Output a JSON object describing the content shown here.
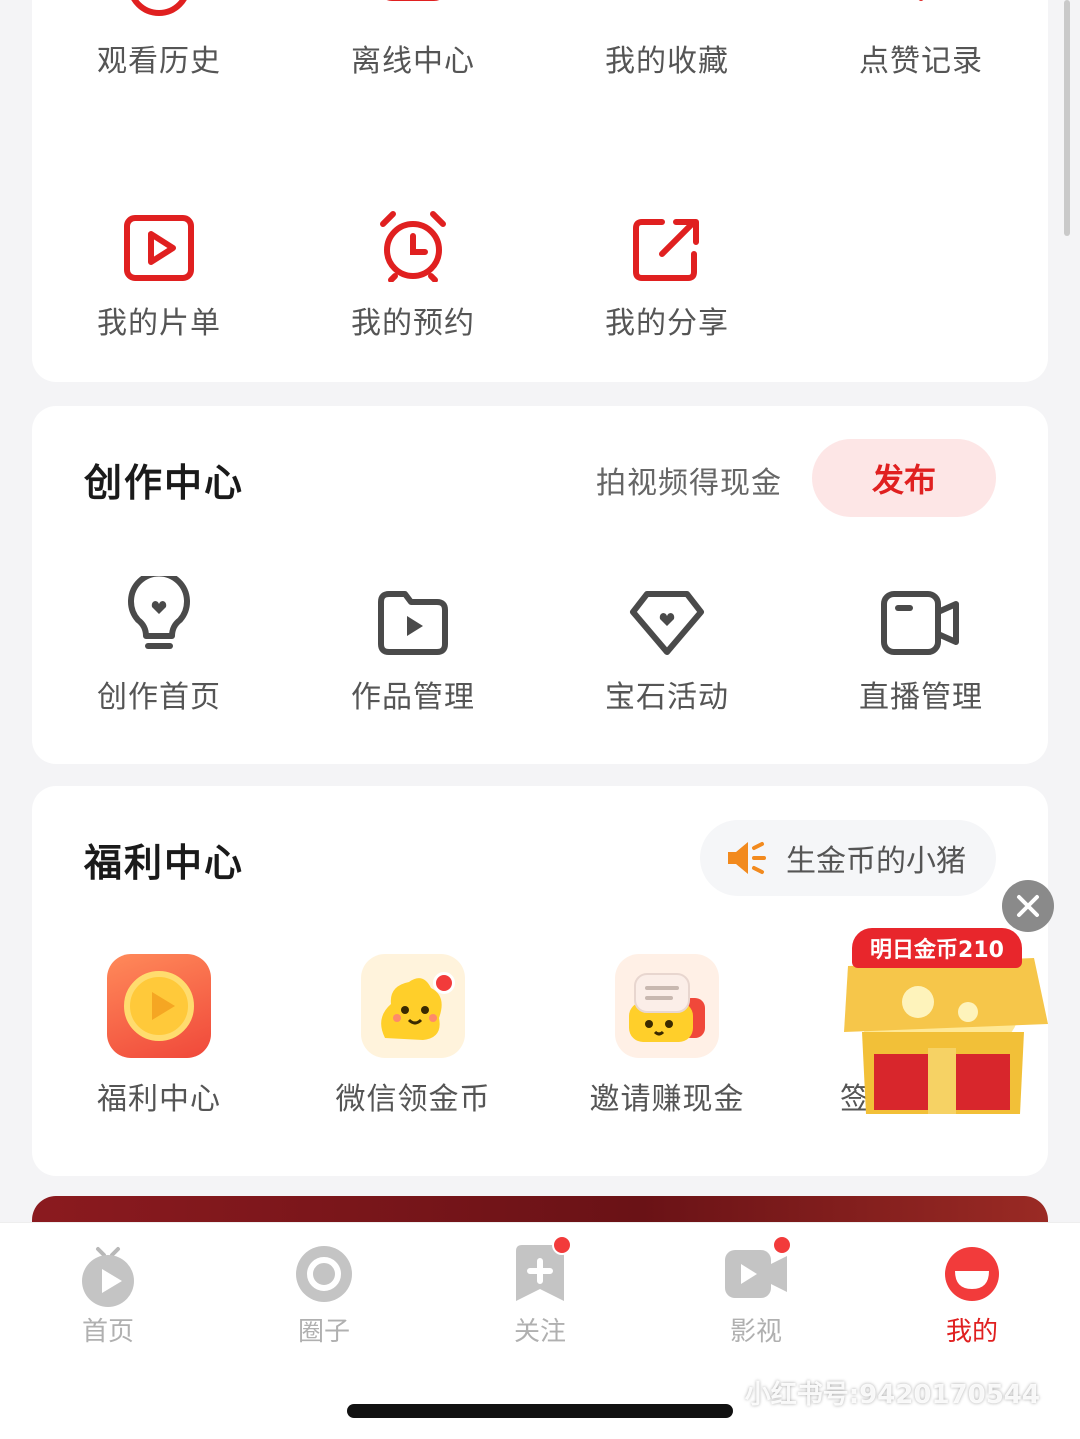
{
  "colors": {
    "accent": "#e02020",
    "icon_dark": "#4a4a4a",
    "page_bg": "#f4f4f6",
    "badge_red": "#f23b3b"
  },
  "quick_row1": [
    {
      "label": "观看历史",
      "icon": "history-icon"
    },
    {
      "label": "离线中心",
      "icon": "download-icon"
    },
    {
      "label": "我的收藏",
      "icon": "bookmark-icon"
    },
    {
      "label": "点赞记录",
      "icon": "heart-icon"
    }
  ],
  "quick_row2": [
    {
      "label": "我的片单",
      "icon": "playlist-icon"
    },
    {
      "label": "我的预约",
      "icon": "alarm-icon"
    },
    {
      "label": "我的分享",
      "icon": "share-icon"
    }
  ],
  "create": {
    "title": "创作中心",
    "promo": "拍视频得现金",
    "publish_label": "发布",
    "items": [
      {
        "label": "创作首页",
        "icon": "lightbulb-icon"
      },
      {
        "label": "作品管理",
        "icon": "folder-play-icon"
      },
      {
        "label": "宝石活动",
        "icon": "gem-icon"
      },
      {
        "label": "直播管理",
        "icon": "camera-icon"
      }
    ]
  },
  "welfare": {
    "title": "福利中心",
    "pill_label": "生金币的小猪",
    "items": [
      {
        "label": "福利中心",
        "icon": "coin-play-icon"
      },
      {
        "label": "微信领金币",
        "icon": "mascot-icon"
      },
      {
        "label": "邀请赚现金",
        "icon": "invite-icon"
      },
      {
        "label": "签",
        "icon": "signin-icon"
      }
    ],
    "chest_badge": "明日金币210"
  },
  "tabbar": [
    {
      "label": "首页",
      "icon": "tv-icon",
      "badge": false
    },
    {
      "label": "圈子",
      "icon": "circle-icon",
      "badge": false
    },
    {
      "label": "关注",
      "icon": "follow-icon",
      "badge": true
    },
    {
      "label": "影视",
      "icon": "video-icon",
      "badge": true
    },
    {
      "label": "我的",
      "icon": "profile-icon",
      "badge": false
    }
  ],
  "watermark": "小红书号:9420170544"
}
